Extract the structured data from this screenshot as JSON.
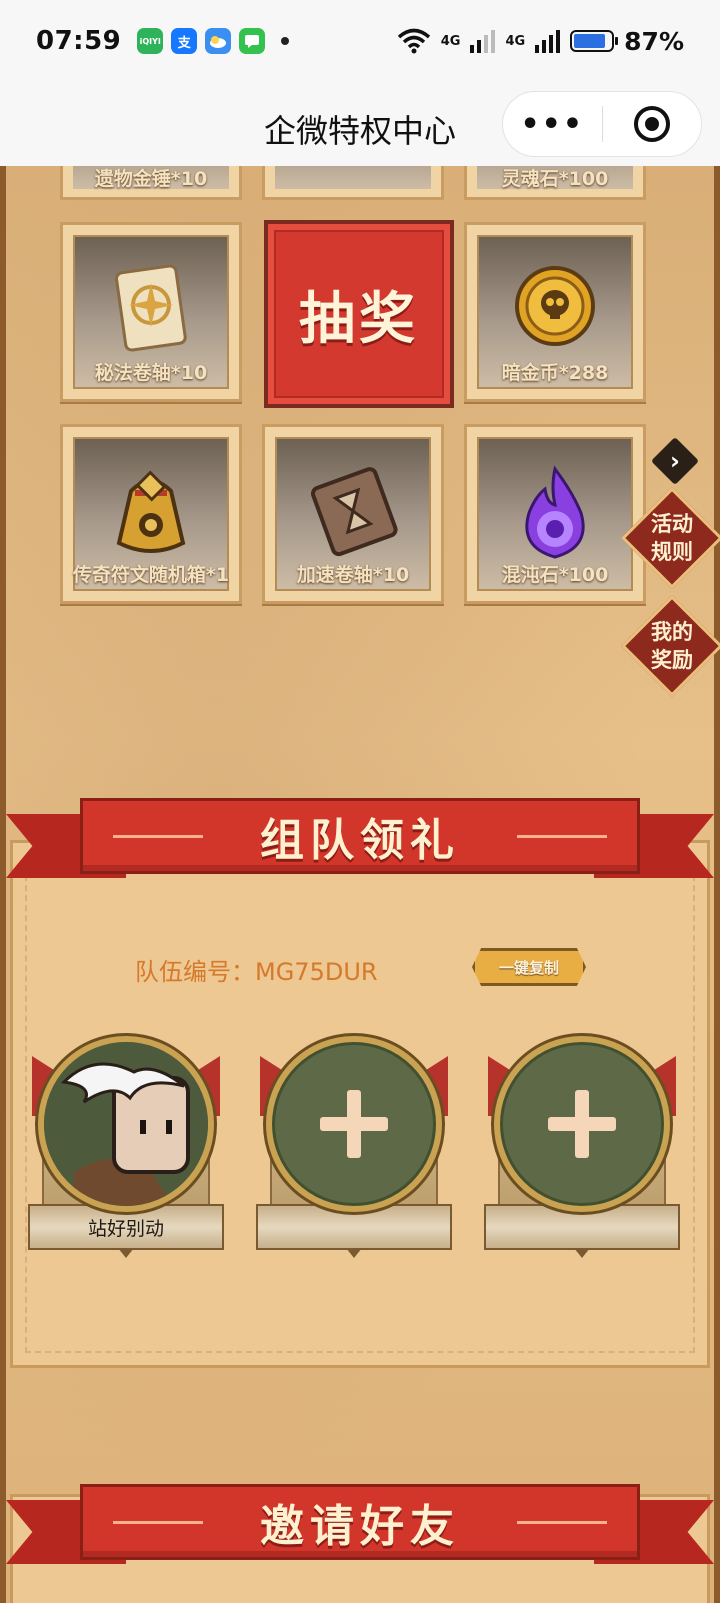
{
  "status_bar": {
    "time": "07:59",
    "app_icons": [
      {
        "name": "iqiyi-icon",
        "color": "#2fb35a",
        "text": "iQIYI"
      },
      {
        "name": "alipay-icon",
        "color": "#1677ff",
        "text": "支"
      },
      {
        "name": "weather-icon",
        "color": "#3a8ff0",
        "text": ""
      },
      {
        "name": "messages-icon",
        "color": "#32c24d",
        "text": ""
      }
    ],
    "network1": "4G",
    "network2": "4G",
    "battery_percent": "87%",
    "battery_level": 0.87
  },
  "nav": {
    "title": "企微特权中心",
    "more_label": "•••"
  },
  "prizes": {
    "top_row": [
      "遗物金锤*10",
      "",
      "灵魂石*100"
    ],
    "middle_row": [
      "秘法卷轴*10",
      "暗金币*288"
    ],
    "bottom_row": [
      "传奇符文随机箱*1",
      "加速卷轴*10",
      "混沌石*100"
    ]
  },
  "draw_button": "抽奖",
  "side_buttons": {
    "rules": [
      "活动",
      "规则"
    ],
    "rewards": [
      "我的",
      "奖励"
    ]
  },
  "team_section": {
    "banner_title": "组队领礼",
    "team_id_label": "队伍编号：MG75DUR",
    "copy_button": "一键复制",
    "members": [
      {
        "name": "站好别动",
        "filled": true
      },
      {
        "name": "",
        "filled": false
      },
      {
        "name": "",
        "filled": false
      }
    ]
  },
  "invite_section": {
    "banner_title": "邀请好友"
  },
  "colors": {
    "banner_red": "#d2362b",
    "parchment": "#edc892",
    "team_id_orange": "#d57a2b"
  }
}
